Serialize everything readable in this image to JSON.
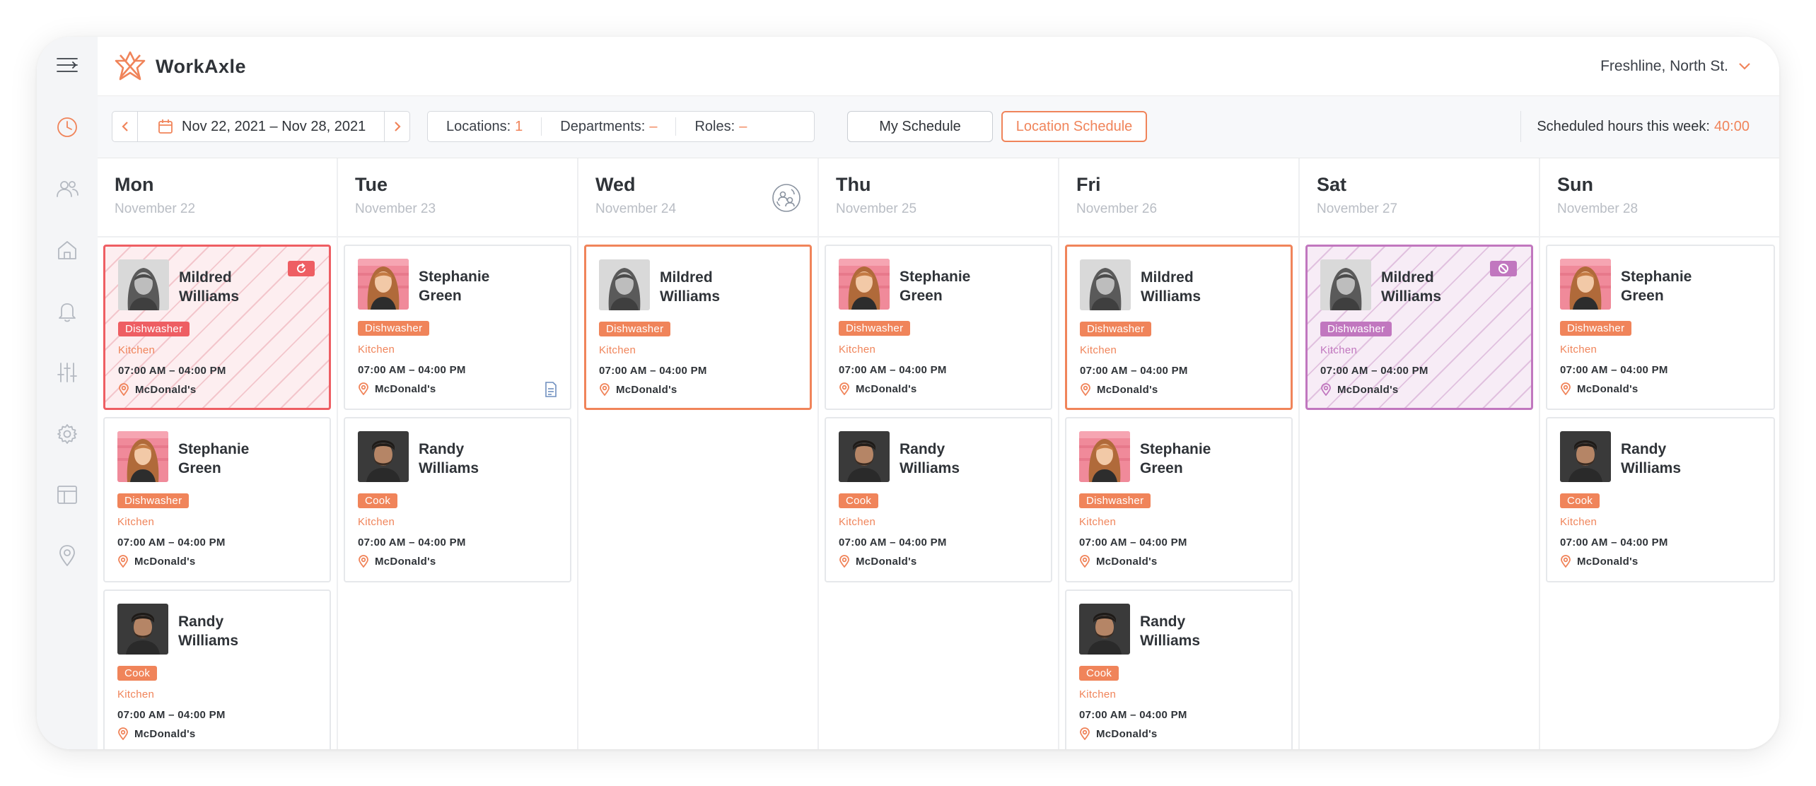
{
  "app": {
    "name": "WorkAxle"
  },
  "company": {
    "name": "Freshline, North St."
  },
  "toolbar": {
    "date_range": "Nov 22, 2021 – Nov 28, 2021",
    "filters": [
      {
        "label": "Locations:",
        "value": "1"
      },
      {
        "label": "Departments:",
        "value": "–"
      },
      {
        "label": "Roles:",
        "value": "–"
      }
    ],
    "my_schedule": "My Schedule",
    "location_schedule": "Location Schedule",
    "hours_label": "Scheduled hours this week:",
    "hours_value": "40:00"
  },
  "colors": {
    "accent": "#f0845a",
    "unavailable": "#ee5e63",
    "time_off": "#c177bf"
  },
  "days": [
    {
      "name": "Mon",
      "date": "November 22",
      "shifts": [
        {
          "first": "Mildred",
          "last": "Williams",
          "role": "Dishwasher",
          "dept": "Kitchen",
          "time": "07:00 AM – 04:00 PM",
          "location": "McDonald's",
          "state": "unavailable",
          "avatar": "mildred",
          "badge": "repeat-icon"
        },
        {
          "first": "Stephanie",
          "last": "Green",
          "role": "Dishwasher",
          "dept": "Kitchen",
          "time": "07:00 AM – 04:00 PM",
          "location": "McDonald's",
          "state": "normal",
          "avatar": "stephanie"
        },
        {
          "first": "Randy",
          "last": "Williams",
          "role": "Cook",
          "dept": "Kitchen",
          "time": "07:00 AM – 04:00 PM",
          "location": "McDonald's",
          "state": "normal",
          "avatar": "randy"
        }
      ]
    },
    {
      "name": "Tue",
      "date": "November 23",
      "shifts": [
        {
          "first": "Stephanie",
          "last": "Green",
          "role": "Dishwasher",
          "dept": "Kitchen",
          "time": "07:00 AM – 04:00 PM",
          "location": "McDonald's",
          "state": "normal",
          "avatar": "stephanie",
          "note": true
        },
        {
          "first": "Randy",
          "last": "Williams",
          "role": "Cook",
          "dept": "Kitchen",
          "time": "07:00 AM – 04:00 PM",
          "location": "McDonald's",
          "state": "normal",
          "avatar": "randy"
        }
      ]
    },
    {
      "name": "Wed",
      "date": "November 24",
      "head_icon": "swap-users-icon",
      "shifts": [
        {
          "first": "Mildred",
          "last": "Williams",
          "role": "Dishwasher",
          "dept": "Kitchen",
          "time": "07:00 AM – 04:00 PM",
          "location": "McDonald's",
          "state": "selected",
          "avatar": "mildred"
        }
      ]
    },
    {
      "name": "Thu",
      "date": "November 25",
      "shifts": [
        {
          "first": "Stephanie",
          "last": "Green",
          "role": "Dishwasher",
          "dept": "Kitchen",
          "time": "07:00 AM – 04:00 PM",
          "location": "McDonald's",
          "state": "normal",
          "avatar": "stephanie"
        },
        {
          "first": "Randy",
          "last": "Williams",
          "role": "Cook",
          "dept": "Kitchen",
          "time": "07:00 AM – 04:00 PM",
          "location": "McDonald's",
          "state": "normal",
          "avatar": "randy"
        }
      ]
    },
    {
      "name": "Fri",
      "date": "November 26",
      "shifts": [
        {
          "first": "Mildred",
          "last": "Williams",
          "role": "Dishwasher",
          "dept": "Kitchen",
          "time": "07:00 AM – 04:00 PM",
          "location": "McDonald's",
          "state": "selected",
          "avatar": "mildred"
        },
        {
          "first": "Stephanie",
          "last": "Green",
          "role": "Dishwasher",
          "dept": "Kitchen",
          "time": "07:00 AM – 04:00 PM",
          "location": "McDonald's",
          "state": "normal",
          "avatar": "stephanie"
        },
        {
          "first": "Randy",
          "last": "Williams",
          "role": "Cook",
          "dept": "Kitchen",
          "time": "07:00 AM – 04:00 PM",
          "location": "McDonald's",
          "state": "normal",
          "avatar": "randy"
        }
      ]
    },
    {
      "name": "Sat",
      "date": "November 27",
      "shifts": [
        {
          "first": "Mildred",
          "last": "Williams",
          "role": "Dishwasher",
          "dept": "Kitchen",
          "time": "07:00 AM – 04:00 PM",
          "location": "McDonald's",
          "state": "timeoff",
          "avatar": "mildred",
          "badge": "block-icon"
        }
      ]
    },
    {
      "name": "Sun",
      "date": "November 28",
      "shifts": [
        {
          "first": "Stephanie",
          "last": "Green",
          "role": "Dishwasher",
          "dept": "Kitchen",
          "time": "07:00 AM – 04:00 PM",
          "location": "McDonald's",
          "state": "normal",
          "avatar": "stephanie"
        },
        {
          "first": "Randy",
          "last": "Williams",
          "role": "Cook",
          "dept": "Kitchen",
          "time": "07:00 AM – 04:00 PM",
          "location": "McDonald's",
          "state": "normal",
          "avatar": "randy"
        }
      ]
    }
  ]
}
